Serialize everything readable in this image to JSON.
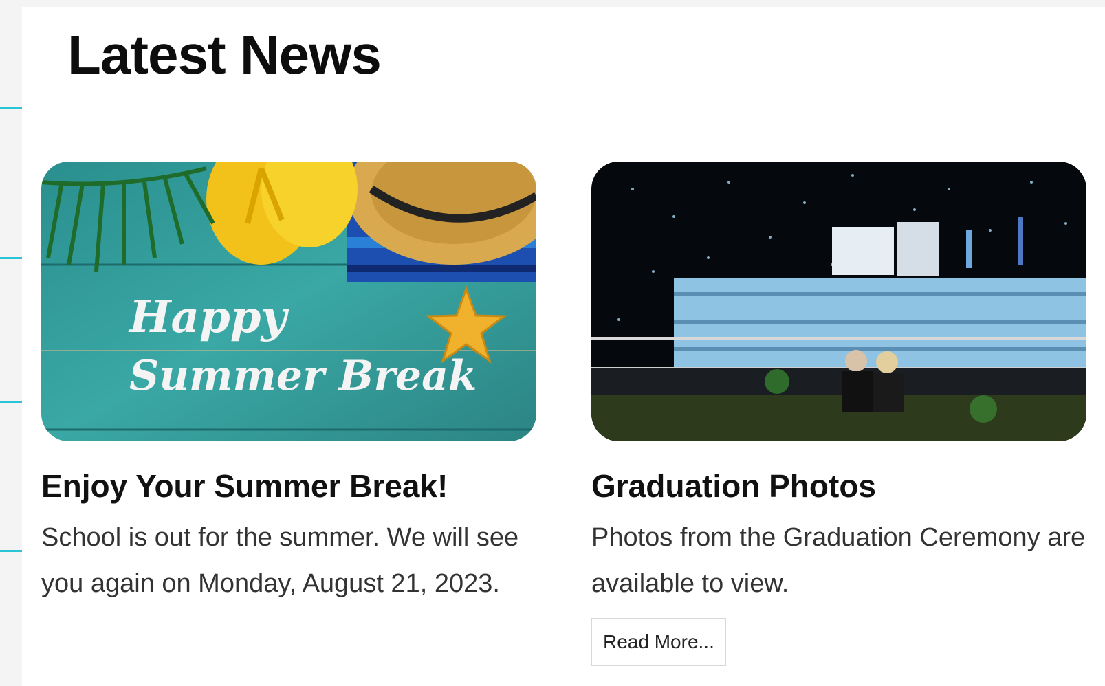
{
  "section": {
    "title": "Latest News"
  },
  "articles": [
    {
      "title": "Enjoy Your Summer Break!",
      "description": "School is out for the summer.  We will see you again on Monday, August 21, 2023.",
      "image_text_line1": "Happy",
      "image_text_line2": "Summer Break"
    },
    {
      "title": "Graduation Photos",
      "description": "Photos from the Graduation Ceremony are available to view.",
      "read_more_label": "Read More..."
    }
  ],
  "colors": {
    "accent": "#29c4d6",
    "heading": "#0d0d0d",
    "body_text": "#333333"
  }
}
